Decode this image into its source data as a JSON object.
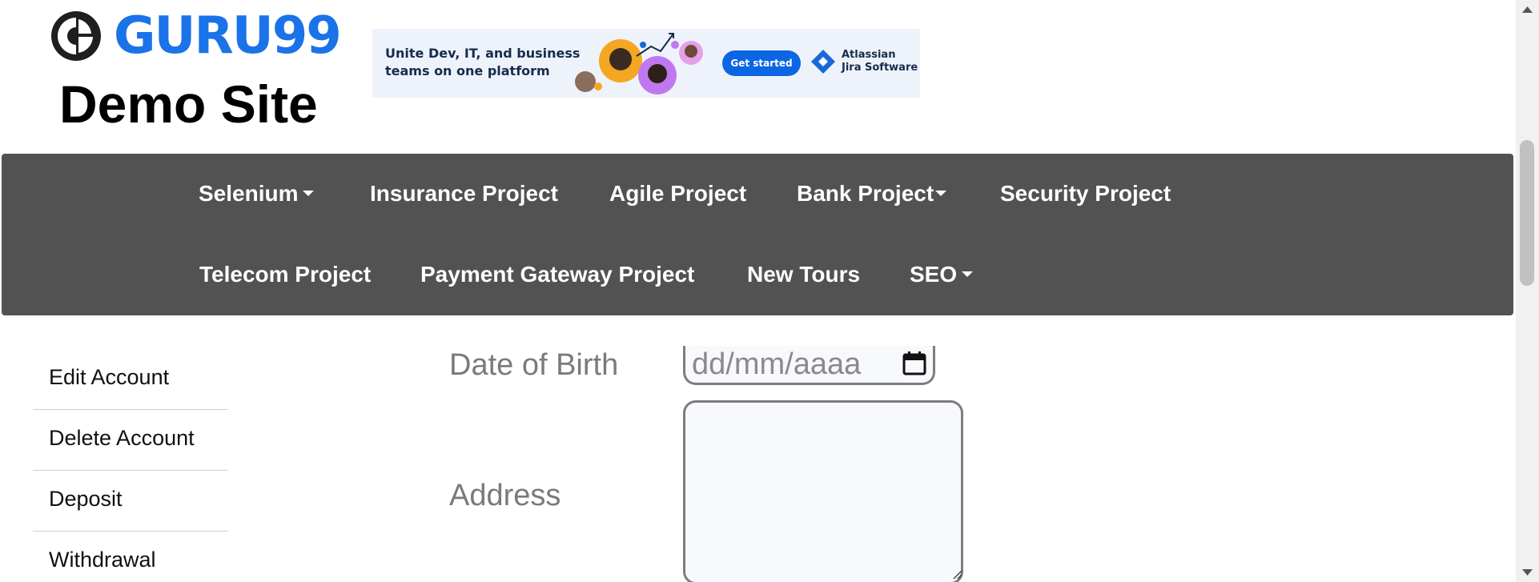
{
  "header": {
    "logo_text": "GURU99",
    "logo_subtitle": "Demo Site"
  },
  "ad": {
    "headline": "Unite Dev, IT, and business teams on one platform",
    "cta": "Get started",
    "brand_line1": "Atlassian",
    "brand_line2": "Jira Software",
    "colors": {
      "background": "#eef3fb",
      "cta": "#0c66e4",
      "text": "#172b4d"
    }
  },
  "nav": {
    "background": "#525252",
    "row1": [
      {
        "label": "Selenium",
        "dropdown": true
      },
      {
        "label": "Insurance Project",
        "dropdown": false
      },
      {
        "label": "Agile Project",
        "dropdown": false
      },
      {
        "label": "Bank Project",
        "dropdown": true
      },
      {
        "label": "Security Project",
        "dropdown": false
      }
    ],
    "row2": [
      {
        "label": "Telecom Project",
        "dropdown": false
      },
      {
        "label": "Payment Gateway Project",
        "dropdown": false
      },
      {
        "label": "New Tours",
        "dropdown": false
      },
      {
        "label": "SEO",
        "dropdown": true
      }
    ]
  },
  "sidebar": {
    "items": [
      {
        "label": "Edit Account"
      },
      {
        "label": "Delete Account"
      },
      {
        "label": "Deposit"
      },
      {
        "label": "Withdrawal"
      }
    ]
  },
  "form": {
    "dob_label": "Date of Birth",
    "dob_placeholder": "dd/mm/aaaa",
    "address_label": "Address",
    "address_value": ""
  },
  "icons": {
    "logo": "guru99-logo-icon",
    "date_picker": "calendar-icon",
    "ad_brand": "jira-diamond-icon"
  }
}
